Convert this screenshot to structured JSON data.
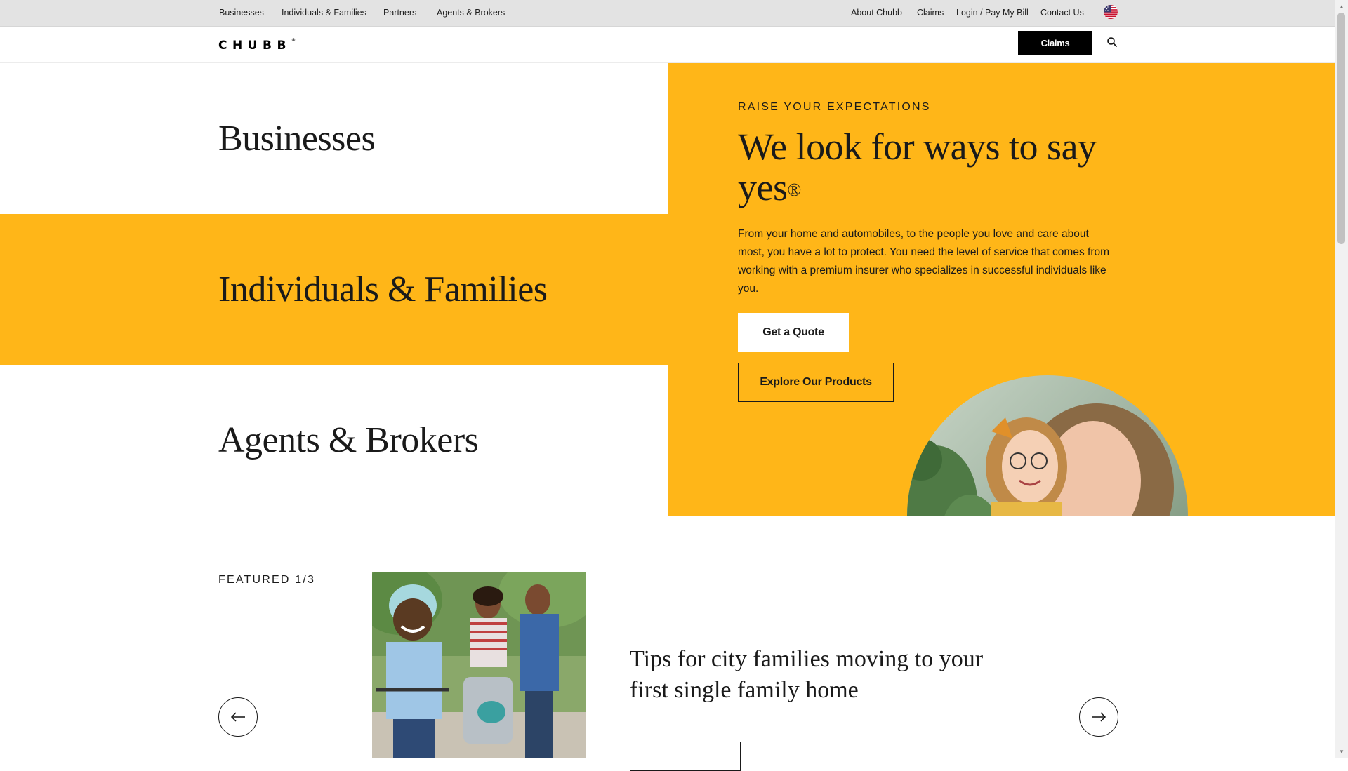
{
  "utility_nav": {
    "left": [
      "Businesses",
      "Individuals & Families",
      "Partners",
      "Agents & Brokers"
    ],
    "right": [
      "About Chubb",
      "Claims",
      "Login / Pay My Bill",
      "Contact Us"
    ],
    "flag_icon": "us-flag-icon"
  },
  "header": {
    "logo": "CHUBB",
    "logo_mark": "®",
    "claims_button": "Claims",
    "search_icon": "search-icon"
  },
  "segments": [
    "Businesses",
    "Individuals & Families",
    "Agents & Brokers"
  ],
  "hero": {
    "eyebrow": "RAISE YOUR EXPECTATIONS",
    "title": "We look for ways to say yes",
    "title_mark": "®",
    "body": "From your home and automobiles, to the people you love and care about most, you have a lot to protect. You need the level of service that comes from working with a premium insurer who specializes in successful individuals like you.",
    "cta_primary": "Get a Quote",
    "cta_secondary": "Explore Our Products"
  },
  "featured": {
    "label": "FEATURED 1/3",
    "title": "Tips for city families moving to your first single family home",
    "prev_icon": "arrow-left-icon",
    "next_icon": "arrow-right-icon"
  },
  "colors": {
    "brand_yellow": "#ffb618",
    "black": "#000000",
    "utility_bar": "#e3e3e3"
  }
}
